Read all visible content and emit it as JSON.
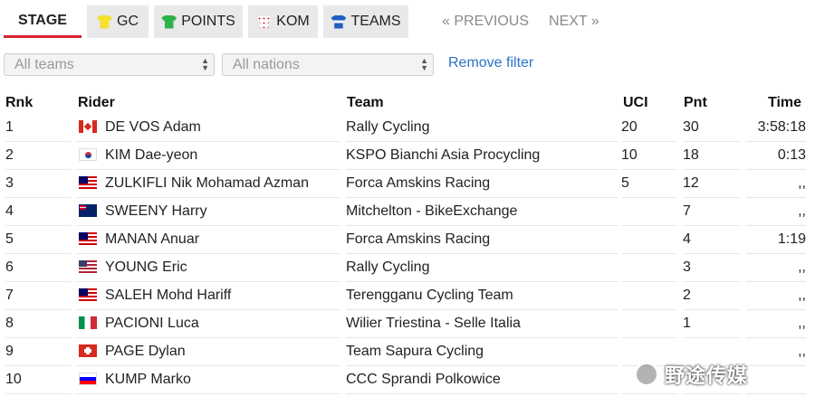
{
  "tabs": [
    {
      "label": "STAGE",
      "icon": "",
      "active": true
    },
    {
      "label": "GC",
      "icon": "yellow-jersey-icon"
    },
    {
      "label": "POINTS",
      "icon": "green-jersey-icon"
    },
    {
      "label": "KOM",
      "icon": "polka-dot-jersey-icon"
    },
    {
      "label": "TEAMS",
      "icon": "blue-white-jersey-icon"
    }
  ],
  "nav": {
    "previous": "« PREVIOUS",
    "next": "NEXT »"
  },
  "filters": {
    "teams": "All teams",
    "nations": "All nations",
    "remove": "Remove filter"
  },
  "table": {
    "headers": {
      "rnk": "Rnk",
      "rider": "Rider",
      "team": "Team",
      "uci": "UCI",
      "pnt": "Pnt",
      "time": "Time"
    },
    "rows": [
      {
        "rnk": "1",
        "flag": "ca",
        "rider": "DE VOS Adam",
        "team": "Rally Cycling",
        "uci": "20",
        "pnt": "30",
        "time": "3:58:18"
      },
      {
        "rnk": "2",
        "flag": "kr",
        "rider": "KIM Dae-yeon",
        "team": "KSPO Bianchi Asia Procycling",
        "uci": "10",
        "pnt": "18",
        "time": "0:13"
      },
      {
        "rnk": "3",
        "flag": "my",
        "rider": "ZULKIFLI Nik Mohamad Azman",
        "team": "Forca Amskins Racing",
        "uci": "5",
        "pnt": "12",
        "time": ",,"
      },
      {
        "rnk": "4",
        "flag": "au",
        "rider": "SWEENY Harry",
        "team": "Mitchelton - BikeExchange",
        "uci": "",
        "pnt": "7",
        "time": ",,"
      },
      {
        "rnk": "5",
        "flag": "my",
        "rider": "MANAN Anuar",
        "team": "Forca Amskins Racing",
        "uci": "",
        "pnt": "4",
        "time": "1:19"
      },
      {
        "rnk": "6",
        "flag": "us",
        "rider": "YOUNG Eric",
        "team": "Rally Cycling",
        "uci": "",
        "pnt": "3",
        "time": ",,"
      },
      {
        "rnk": "7",
        "flag": "my",
        "rider": "SALEH Mohd Hariff",
        "team": "Terengganu Cycling Team",
        "uci": "",
        "pnt": "2",
        "time": ",,"
      },
      {
        "rnk": "8",
        "flag": "it",
        "rider": "PACIONI Luca",
        "team": "Wilier Triestina - Selle Italia",
        "uci": "",
        "pnt": "1",
        "time": ",,"
      },
      {
        "rnk": "9",
        "flag": "ch",
        "rider": "PAGE Dylan",
        "team": "Team Sapura Cycling",
        "uci": "",
        "pnt": "",
        "time": ",,"
      },
      {
        "rnk": "10",
        "flag": "si",
        "rider": "KUMP Marko",
        "team": "CCC Sprandi Polkowice",
        "uci": "",
        "pnt": "",
        "time": ""
      }
    ]
  },
  "watermark": {
    "text": "野途传媒"
  },
  "colors": {
    "accent": "#d9232d",
    "link": "#2b72c7",
    "tab_bg": "#e9e9e9"
  }
}
